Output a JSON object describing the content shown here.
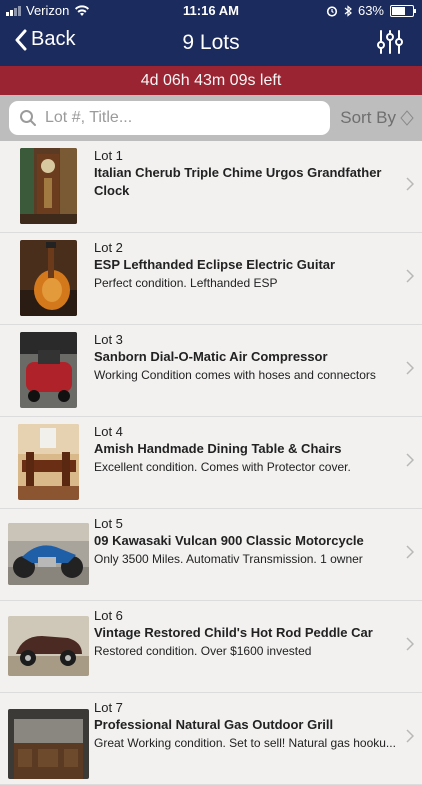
{
  "status": {
    "carrier": "Verizon",
    "time": "11:16 AM",
    "battery": "63%",
    "battery_level": 0.63
  },
  "nav": {
    "back_label": "Back",
    "title": "9 Lots"
  },
  "timer": {
    "text": "4d 06h 43m 09s left"
  },
  "search": {
    "placeholder": "Lot #, Title...",
    "sort_label": "Sort By"
  },
  "lots": [
    {
      "lot": "Lot 1",
      "title": "Italian Cherub Triple Chime Urgos Grandfather Clock",
      "desc": ""
    },
    {
      "lot": "Lot 2",
      "title": "ESP Lefthanded Eclipse Electric Guitar",
      "desc": "Perfect condition. Lefthanded ESP"
    },
    {
      "lot": "Lot 3",
      "title": "Sanborn Dial-O-Matic Air Compressor",
      "desc": "Working Condition comes with hoses and connectors"
    },
    {
      "lot": "Lot 4",
      "title": "Amish Handmade Dining Table & Chairs",
      "desc": "Excellent condition. Comes with Protector cover."
    },
    {
      "lot": "Lot 5",
      "title": "09 Kawasaki Vulcan 900 Classic Motorcycle",
      "desc": "Only 3500 Miles. Automativ Transmission. 1 owner"
    },
    {
      "lot": "Lot 6",
      "title": "Vintage Restored Child's Hot Rod Peddle Car",
      "desc": "Restored condition. Over $1600 invested"
    },
    {
      "lot": "Lot 7",
      "title": "Professional Natural Gas Outdoor Grill",
      "desc": "Great Working condition. Set to sell! Natural gas hooku..."
    }
  ]
}
